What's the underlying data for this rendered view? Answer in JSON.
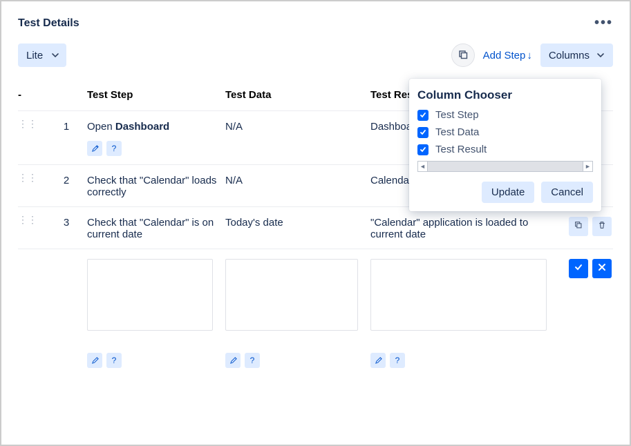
{
  "header": {
    "title": "Test Details"
  },
  "toolbar": {
    "mode_select": "Lite",
    "add_step_label": "Add Step",
    "columns_label": "Columns"
  },
  "table": {
    "headers": {
      "drag": "-",
      "step": "Test Step",
      "data": "Test Data",
      "result": "Test Result"
    },
    "rows": [
      {
        "num": "1",
        "step_prefix": "Open ",
        "step_bold": "Dashboard",
        "step_suffix": "",
        "data": "N/A",
        "result": "Dashboard"
      },
      {
        "num": "2",
        "step_prefix": "Check that \"Calendar\" loads correctly",
        "step_bold": "",
        "step_suffix": "",
        "data": "N/A",
        "result": "Calendar"
      },
      {
        "num": "3",
        "step_prefix": "Check that \"Calendar\" is on current date",
        "step_bold": "",
        "step_suffix": "",
        "data": "Today's date",
        "result": "\"Calendar\" application is loaded to current date"
      }
    ]
  },
  "popup": {
    "title": "Column Chooser",
    "options": [
      {
        "label": "Test Step",
        "checked": true
      },
      {
        "label": "Test Data",
        "checked": true
      },
      {
        "label": "Test Result",
        "checked": true
      }
    ],
    "update_label": "Update",
    "cancel_label": "Cancel"
  }
}
